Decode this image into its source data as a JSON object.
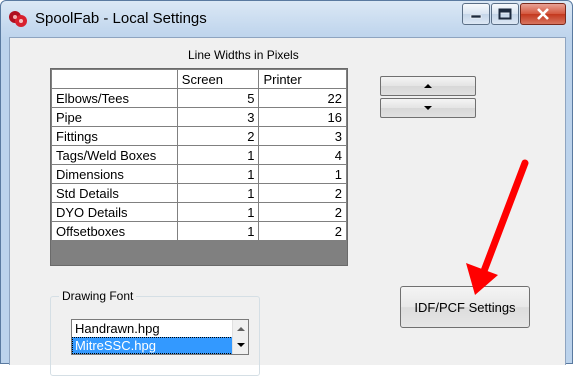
{
  "window": {
    "title": "SpoolFab - Local Settings",
    "icon": "red-spool-icon",
    "caption_buttons": [
      "minimize-icon",
      "maximize-icon",
      "close-icon"
    ]
  },
  "line_widths": {
    "title": "Line Widths in Pixels",
    "columns": [
      "Screen",
      "Printer"
    ],
    "rows": [
      {
        "label": "Elbows/Tees",
        "screen": "5",
        "printer": "22"
      },
      {
        "label": "Pipe",
        "screen": "3",
        "printer": "16"
      },
      {
        "label": "Fittings",
        "screen": "2",
        "printer": "3"
      },
      {
        "label": "Tags/Weld Boxes",
        "screen": "1",
        "printer": "4"
      },
      {
        "label": "Dimensions",
        "screen": "1",
        "printer": "1"
      },
      {
        "label": "Std Details",
        "screen": "1",
        "printer": "2"
      },
      {
        "label": "DYO Details",
        "screen": "1",
        "printer": "2"
      },
      {
        "label": "Offsetboxes",
        "screen": "1",
        "printer": "2"
      }
    ]
  },
  "buttons": {
    "up_icon": "up-arrow-icon",
    "down_icon": "down-arrow-icon",
    "idf_pcf_label": "IDF/PCF Settings"
  },
  "drawing_font": {
    "legend": "Drawing Font",
    "items": [
      "Handrawn.hpg",
      "MitreSSC.hpg"
    ],
    "selected": "MitreSSC.hpg"
  },
  "colors": {
    "selection": "#3399ff",
    "annotation_arrow": "#ff0000",
    "close_button": "#c3381e"
  }
}
